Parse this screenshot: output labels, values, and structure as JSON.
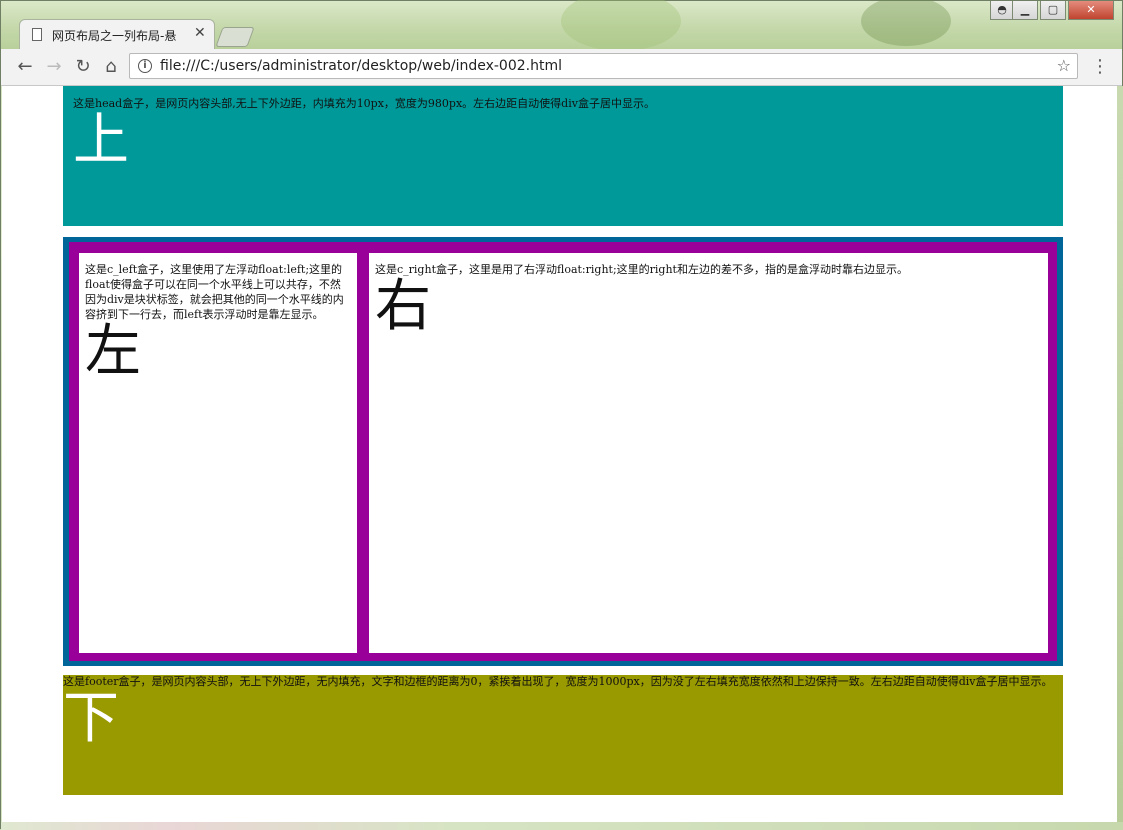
{
  "browser": {
    "tab_title": "网页布局之一列布局-悬",
    "url": "file:///C:/users/administrator/desktop/web/index-002.html"
  },
  "page": {
    "head": {
      "desc": "这是head盒子，是网页内容头部,无上下外边距，内填充为10px，宽度为980px。左右边距自动使得div盒子居中显示。",
      "big": "上"
    },
    "left": {
      "desc": "这是c_left盒子，这里使用了左浮动float:left;这里的float使得盒子可以在同一个水平线上可以共存，不然因为div是块状标签，就会把其他的同一个水平线的内容挤到下一行去，而left表示浮动时是靠左显示。",
      "big": "左"
    },
    "right": {
      "desc": "这是c_right盒子，这里是用了右浮动float:right;这里的right和左边的差不多，指的是盒浮动时靠右边显示。",
      "big": "右"
    },
    "footer": {
      "desc": "这是footer盒子，是网页内容头部，无上下外边距，无内填充，文字和边框的距离为0，紧挨着出现了，宽度为1000px，因为没了左右填充宽度依然和上边保持一致。左右边距自动使得div盒子居中显示。",
      "big": "下"
    }
  },
  "colors": {
    "head": "#009999",
    "main_outer": "#006699",
    "main_inner": "#990099",
    "footer": "#999900"
  }
}
